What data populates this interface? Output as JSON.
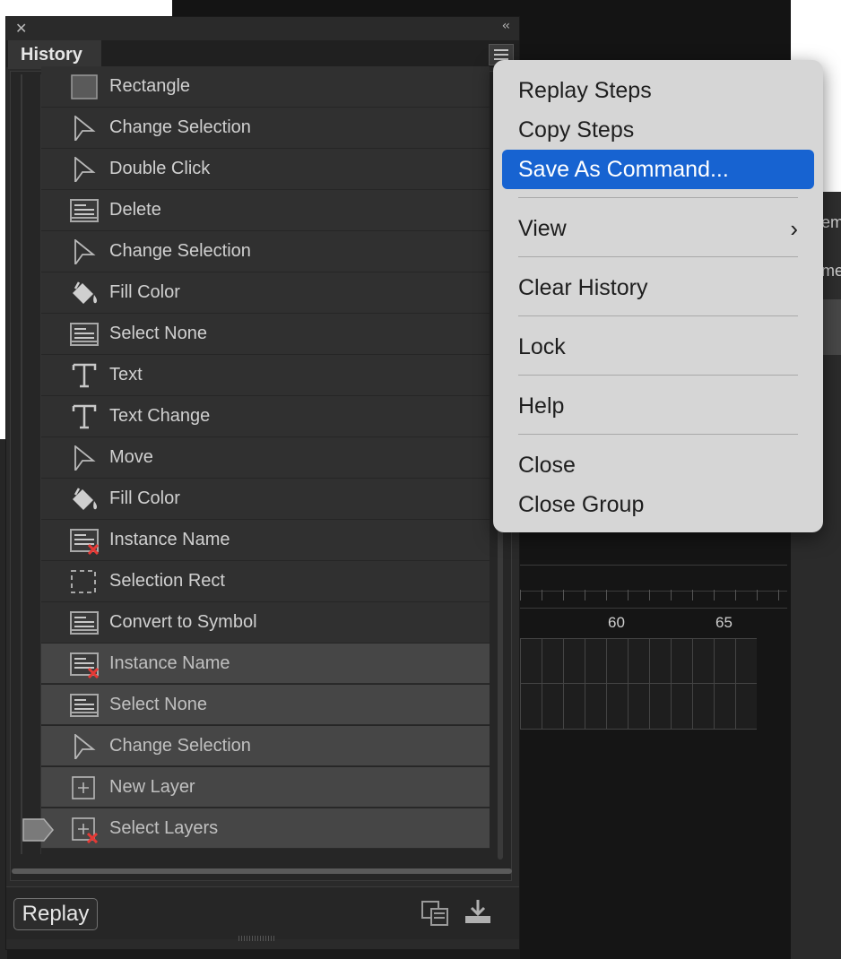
{
  "panel": {
    "tab_title": "History",
    "history_items": [
      {
        "icon": "rectangle-icon",
        "label": "Rectangle"
      },
      {
        "icon": "arrow-pointer-icon",
        "label": "Change Selection"
      },
      {
        "icon": "arrow-pointer-icon",
        "label": "Double Click"
      },
      {
        "icon": "document-icon",
        "label": "Delete"
      },
      {
        "icon": "arrow-pointer-icon",
        "label": "Change Selection"
      },
      {
        "icon": "paint-bucket-icon",
        "label": "Fill Color"
      },
      {
        "icon": "document-icon",
        "label": "Select None"
      },
      {
        "icon": "text-tool-icon",
        "label": "Text"
      },
      {
        "icon": "text-tool-icon",
        "label": "Text Change"
      },
      {
        "icon": "arrow-pointer-icon",
        "label": "Move"
      },
      {
        "icon": "paint-bucket-icon",
        "label": "Fill Color"
      },
      {
        "icon": "document-error-icon",
        "label": "Instance Name"
      },
      {
        "icon": "selection-rect-icon",
        "label": "Selection Rect"
      },
      {
        "icon": "document-icon",
        "label": "Convert to Symbol"
      },
      {
        "icon": "document-error-icon",
        "label": "Instance Name"
      },
      {
        "icon": "document-icon",
        "label": "Select None"
      },
      {
        "icon": "arrow-pointer-icon",
        "label": "Change Selection"
      },
      {
        "icon": "new-layer-icon",
        "label": "New Layer"
      },
      {
        "icon": "new-layer-error-icon",
        "label": "Select Layers"
      }
    ],
    "replay_label": "Replay"
  },
  "menu": {
    "items": [
      {
        "label": "Replay Steps"
      },
      {
        "label": "Copy Steps"
      },
      {
        "label": "Save As Command...",
        "selected": true
      },
      {
        "label": "View",
        "submenu": true
      },
      {
        "label": "Clear History"
      },
      {
        "label": "Lock"
      },
      {
        "label": "Help"
      },
      {
        "label": "Close"
      },
      {
        "label": "Close Group"
      }
    ],
    "submenu_glyph": "›"
  },
  "background": {
    "timeline_numbers": [
      "60",
      "65"
    ],
    "partial_text_1": "em",
    "partial_text_2": "me"
  },
  "colors": {
    "selection": "#1763d1",
    "panel_bg": "#2a2a2a",
    "menu_bg": "#d6d6d6",
    "error_mark": "#e53935"
  }
}
